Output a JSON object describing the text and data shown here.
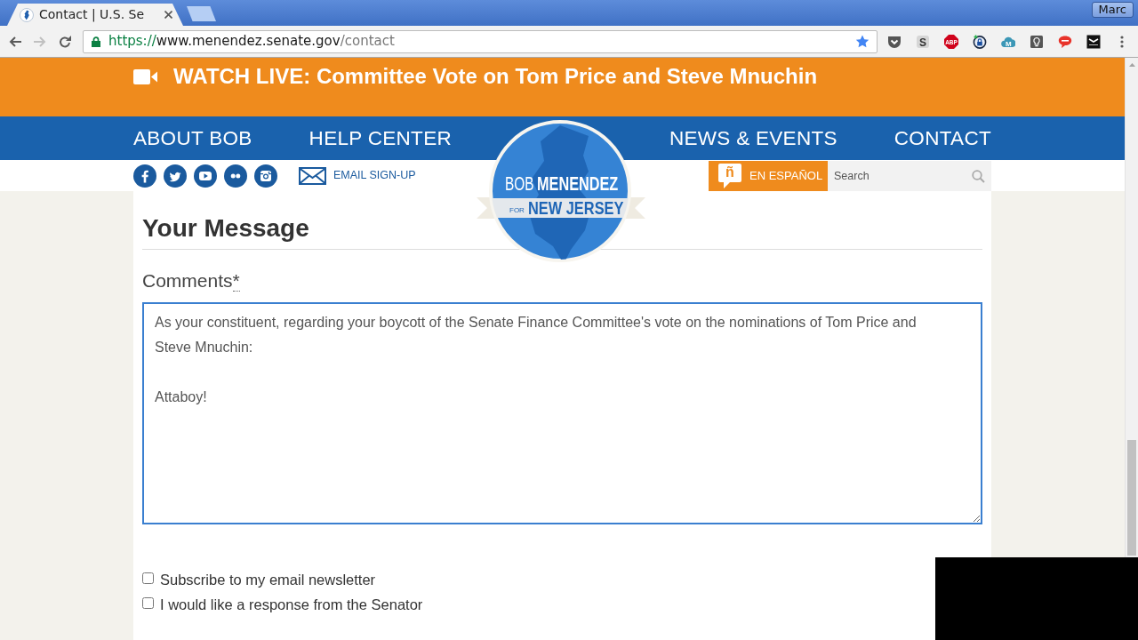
{
  "browser": {
    "tabs": [
      {
        "title": "Contact | U.S. Se",
        "selected": true
      }
    ],
    "profile": "Marc",
    "nav_buttons": [
      {
        "kind": "back",
        "disabled": false
      },
      {
        "kind": "forward",
        "disabled": true
      },
      {
        "kind": "reload",
        "disabled": false
      }
    ],
    "address": {
      "secure": true,
      "scheme": "https://",
      "host": "www.menendez.senate.gov",
      "path": "/contact"
    },
    "bookmarked": true,
    "extensions": [
      {
        "kind": "shield"
      },
      {
        "kind": "letter",
        "glyph": "S"
      },
      {
        "kind": "octagon",
        "glyph": "ABP"
      },
      {
        "kind": "ring"
      },
      {
        "kind": "cloud",
        "glyph": "M"
      },
      {
        "kind": "bulb"
      },
      {
        "kind": "bubble"
      },
      {
        "kind": "tile"
      }
    ]
  },
  "alert": {
    "text": "WATCH LIVE: Committee Vote on Tom Price and Steve Mnuchin"
  },
  "main_nav": [
    "ABOUT BOB",
    "HELP CENTER",
    "NEWS & EVENTS",
    "CONTACT"
  ],
  "logo": {
    "first_name": "BOB",
    "last_name": "MENENDEZ",
    "for": "FOR",
    "state": "NEW JERSEY"
  },
  "social": [
    {
      "kind": "facebook"
    },
    {
      "kind": "twitter"
    },
    {
      "kind": "youtube"
    },
    {
      "kind": "flickr"
    },
    {
      "kind": "instagram"
    }
  ],
  "email_signup": "EMAIL SIGN-UP",
  "spanish": {
    "glyph": "ñ",
    "label": "EN ESPAÑOL"
  },
  "search": {
    "placeholder": "Search"
  },
  "form": {
    "heading": "Your Message",
    "comments": {
      "label": "Comments",
      "required_mark": "*",
      "value": "As your constituent, regarding your boycott of the Senate Finance Committee's vote on the nominations of Tom Price and Steve Mnuchin:\n\nAttaboy!",
      "focused": true
    },
    "checkboxes": [
      {
        "label": "Subscribe to my email newsletter",
        "checked": false
      },
      {
        "label": "I would like a response from the Senator",
        "checked": false
      }
    ]
  }
}
